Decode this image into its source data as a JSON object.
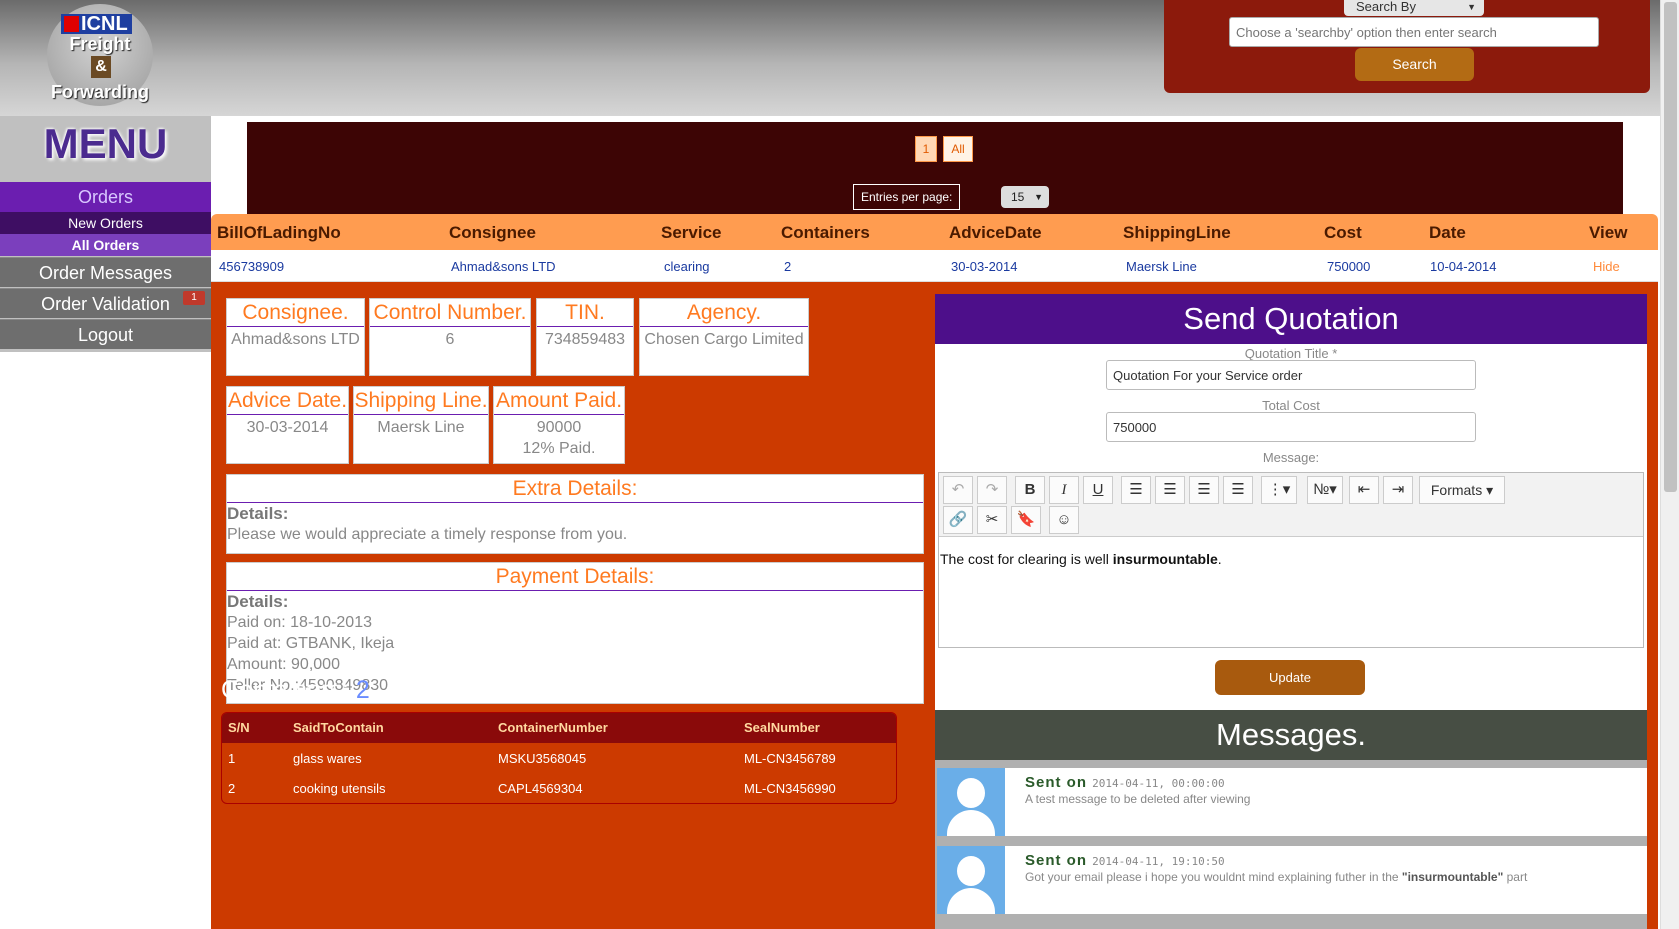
{
  "logo": {
    "brand": "ICNL",
    "line1": "Freight",
    "amp": "&",
    "line2": "Forwarding"
  },
  "search": {
    "searchby": "Search By",
    "placeholder": "Choose a 'searchby' option then enter search",
    "button": "Search"
  },
  "menu": {
    "title": "MENU",
    "orders": "Orders",
    "new_orders": "New Orders",
    "all_orders": "All Orders",
    "order_messages": "Order Messages",
    "order_validation": "Order Validation",
    "validation_badge": "1",
    "logout": "Logout"
  },
  "pager": {
    "page": "1",
    "all": "All",
    "entries_label": "Entries per page:",
    "entries_value": "15"
  },
  "orders_table": {
    "headers": [
      "BillOfLadingNo",
      "Consignee",
      "Service",
      "Containers",
      "AdviceDate",
      "ShippingLine",
      "Cost",
      "Date",
      "View"
    ],
    "row": [
      "456738909",
      "Ahmad&sons LTD",
      "clearing",
      "2",
      "30-03-2014",
      "Maersk Line",
      "750000",
      "10-04-2014",
      "Hide"
    ]
  },
  "details": {
    "consignee": {
      "label": "Consignee.",
      "value": "Ahmad&sons LTD"
    },
    "control": {
      "label": "Control Number.",
      "value": "6"
    },
    "tin": {
      "label": "TIN.",
      "value": "734859483"
    },
    "agency": {
      "label": "Agency.",
      "value": "Chosen Cargo Limited"
    },
    "advice": {
      "label": "Advice Date.",
      "value": "30-03-2014"
    },
    "shipping": {
      "label": "Shipping Line.",
      "value": "Maersk Line"
    },
    "amount": {
      "label": "Amount Paid.",
      "value": "90000",
      "percent": "12% Paid."
    },
    "extra": {
      "label": "Extra Details:",
      "details_label": "Details:",
      "text": "Please we would appreciate a timely response from you."
    },
    "payment": {
      "label": "Payment Details:",
      "details_label": "Details:",
      "paid_on": "Paid on: 18-10-2013",
      "paid_at": "Paid at: GTBANK, Ikeja",
      "amount": "Amount: 90,000",
      "teller": "Teller No.:4590849830"
    }
  },
  "containers": {
    "title": "Containers:",
    "count": "2",
    "headers": [
      "S/N",
      "SaidToContain",
      "ContainerNumber",
      "SealNumber"
    ],
    "rows": [
      [
        "1",
        "glass wares",
        "MSKU3568045",
        "ML-CN3456789"
      ],
      [
        "2",
        "cooking utensils",
        "CAPL4569304",
        "ML-CN3456990"
      ]
    ]
  },
  "quotation": {
    "title": "Send Quotation",
    "title_label": "Quotation Title *",
    "title_value": "Quotation For your Service order",
    "cost_label": "Total Cost",
    "cost_value": "750000",
    "message_label": "Message:",
    "formats": "Formats",
    "body_prefix": "The cost for clearing is well ",
    "body_bold": "insurmountable",
    "body_suffix": ".",
    "update": "Update"
  },
  "messages": {
    "title": "Messages.",
    "items": [
      {
        "sent": "Sent on",
        "ts": "2014-04-11, 00:00:00",
        "text": "A test message to be deleted after viewing",
        "bold": "",
        "after": ""
      },
      {
        "sent": "Sent on",
        "ts": "2014-04-11, 19:10:50",
        "text": "Got your email please i hope you wouldnt mind explaining futher in the ",
        "bold": "\"insurmountable\"",
        "after": " part"
      }
    ]
  },
  "colors": {
    "menu_purple": "#6b1eb0",
    "detail_orange": "#cc3a00",
    "header_orange": "#ff9c50",
    "search_red": "#8c1a0c"
  }
}
